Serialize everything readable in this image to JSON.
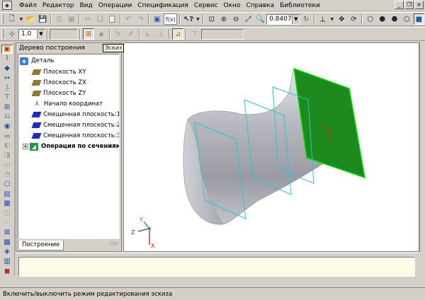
{
  "menu": {
    "items": [
      "Файл",
      "Редактор",
      "Вид",
      "Операции",
      "Спецификация",
      "Сервис",
      "Окно",
      "Справка",
      "Библиотеки"
    ]
  },
  "toolbar": {
    "zoom_value": "0.8407",
    "step_value": "1.0",
    "fx_label": "f(x)"
  },
  "tree": {
    "title": "Дерево построения",
    "tooltip": "Эскиз",
    "root": "Деталь",
    "items": [
      {
        "label": "Плоскость XY",
        "icon": "plane-icon"
      },
      {
        "label": "Плоскость ZX",
        "icon": "plane-icon"
      },
      {
        "label": "Плоскость ZY",
        "icon": "plane-icon"
      },
      {
        "label": "Начало координат",
        "icon": "origin-icon"
      },
      {
        "label": "Смещенная плоскость:1",
        "icon": "offset-plane-icon"
      },
      {
        "label": "Смещенная плоскость:2",
        "icon": "offset-plane-icon"
      },
      {
        "label": "Смещенная плоскость:3",
        "icon": "offset-plane-icon"
      }
    ],
    "operation": "Операция по сечениям:1",
    "tab": "Построение"
  },
  "axes": {
    "x": "X",
    "y": "Y",
    "z": "Z"
  },
  "colors": {
    "selected_face": "#1e8a1e",
    "section_outline": "#2bc4d8",
    "axis_x": "#e02020",
    "axis_y": "#20a020",
    "axis_z": "#2040d0"
  },
  "status": {
    "text": "Включить/выключить режим редактирования эскиза"
  }
}
